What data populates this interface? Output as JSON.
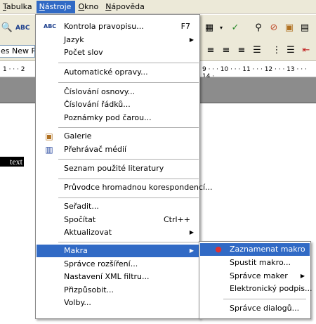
{
  "menubar": [
    {
      "label": "Tabulka",
      "u": "T",
      "rest": "abulka"
    },
    {
      "label": "Nástroje",
      "u": "N",
      "rest": "ástroje"
    },
    {
      "label": "Okno",
      "u": "O",
      "rest": "kno"
    },
    {
      "label": "Nápověda",
      "u": "N",
      "rest": "ápověda"
    }
  ],
  "font": {
    "name": "es New Ro"
  },
  "ruler": {
    "left": "1 · · · 2",
    "right": "9 · · · 10 · · · 11 · · · 12 · · · 13 · · · 14 ·"
  },
  "document": {
    "selected_text": "text"
  },
  "tools_menu": {
    "spelling": {
      "label": "Kontrola pravopisu...",
      "shortcut": "F7"
    },
    "language": {
      "label": "Jazyk"
    },
    "word_count": {
      "label": "Počet slov"
    },
    "autocorrect": {
      "label": "Automatické opravy..."
    },
    "outline_numbering": {
      "label": "Číslování osnovy..."
    },
    "line_numbering": {
      "label": "Číslování řádků..."
    },
    "footnotes": {
      "label": "Poznámky pod čarou..."
    },
    "gallery": {
      "label": "Galerie"
    },
    "media_player": {
      "label": "Přehrávač médií"
    },
    "bibliography": {
      "label": "Seznam použité literatury"
    },
    "mail_merge": {
      "label": "Průvodce hromadnou korespondencí..."
    },
    "sort": {
      "label": "Seřadit..."
    },
    "calculate": {
      "label": "Spočítat",
      "shortcut": "Ctrl++"
    },
    "update": {
      "label": "Aktualizovat"
    },
    "macros": {
      "label": "Makra"
    },
    "extension_manager": {
      "label": "Správce rozšíření..."
    },
    "xml_filter": {
      "label": "Nastavení XML filtru..."
    },
    "customize": {
      "label": "Přizpůsobit..."
    },
    "options": {
      "label": "Volby..."
    }
  },
  "macros_submenu": {
    "record": {
      "label": "Zaznamenat makro"
    },
    "run": {
      "label": "Spustit makro..."
    },
    "organizer": {
      "label": "Správce maker"
    },
    "digital_signature": {
      "label": "Elektronický podpis..."
    },
    "dialog_manager": {
      "label": "Správce dialogů..."
    }
  },
  "colors": {
    "highlight": "#316ac5",
    "menubar_bg": "#ece9d8"
  }
}
